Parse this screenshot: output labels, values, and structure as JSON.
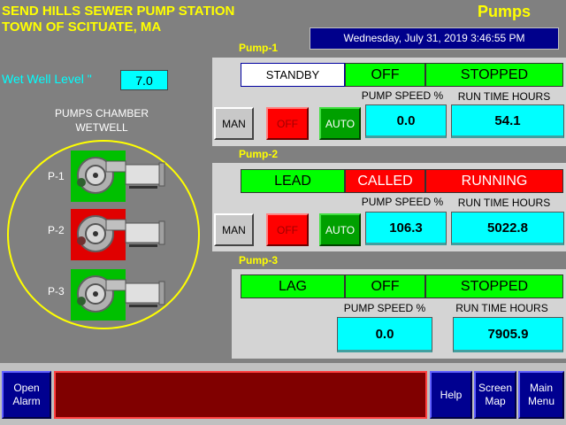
{
  "header": {
    "title_line1": "SEND HILLS SEWER PUMP STATION",
    "title_line2": "TOWN OF SCITUATE, MA",
    "screen_title": "Pumps",
    "datetime": "Wednesday, July 31, 2019 3:46:55 PM"
  },
  "wetwell": {
    "label": "Wet Well Level \"",
    "value": "7.0"
  },
  "chamber": {
    "line1": "PUMPS CHAMBER",
    "line2": "WETWELL"
  },
  "pump_icons": [
    {
      "label": "P-1",
      "state": "off",
      "color": "#00c000"
    },
    {
      "label": "P-2",
      "state": "running",
      "color": "#e00000"
    },
    {
      "label": "P-3",
      "state": "off",
      "color": "#00c000"
    }
  ],
  "pumps": [
    {
      "title": "Pump-1",
      "role": "STANDBY",
      "call": "OFF",
      "status": "STOPPED",
      "speed_header": "PUMP SPEED %",
      "runtime_header": "RUN TIME HOURS",
      "speed": "0.0",
      "runtime": "54.1",
      "man": "MAN",
      "off": "OFF",
      "auto": "AUTO"
    },
    {
      "title": "Pump-2",
      "role": "LEAD",
      "call": "CALLED",
      "status": "RUNNING",
      "speed_header": "PUMP SPEED %",
      "runtime_header": "RUN TIME HOURS",
      "speed": "106.3",
      "runtime": "5022.8",
      "man": "MAN",
      "off": "OFF",
      "auto": "AUTO"
    },
    {
      "title": "Pump-3",
      "role": "LAG",
      "call": "OFF",
      "status": "STOPPED",
      "speed_header": "PUMP SPEED %",
      "runtime_header": "RUN TIME HOURS",
      "speed": "0.0",
      "runtime": "7905.9"
    }
  ],
  "footer": {
    "open_alarm": "Open\nAlarm",
    "help": "Help",
    "screen_map": "Screen\nMap",
    "main_menu": "Main\nMenu"
  },
  "colors": {
    "green": "#00ff00",
    "red": "#ff0000",
    "cyan": "#00ffff",
    "yellow": "#ffff00",
    "navy": "#00008b"
  }
}
